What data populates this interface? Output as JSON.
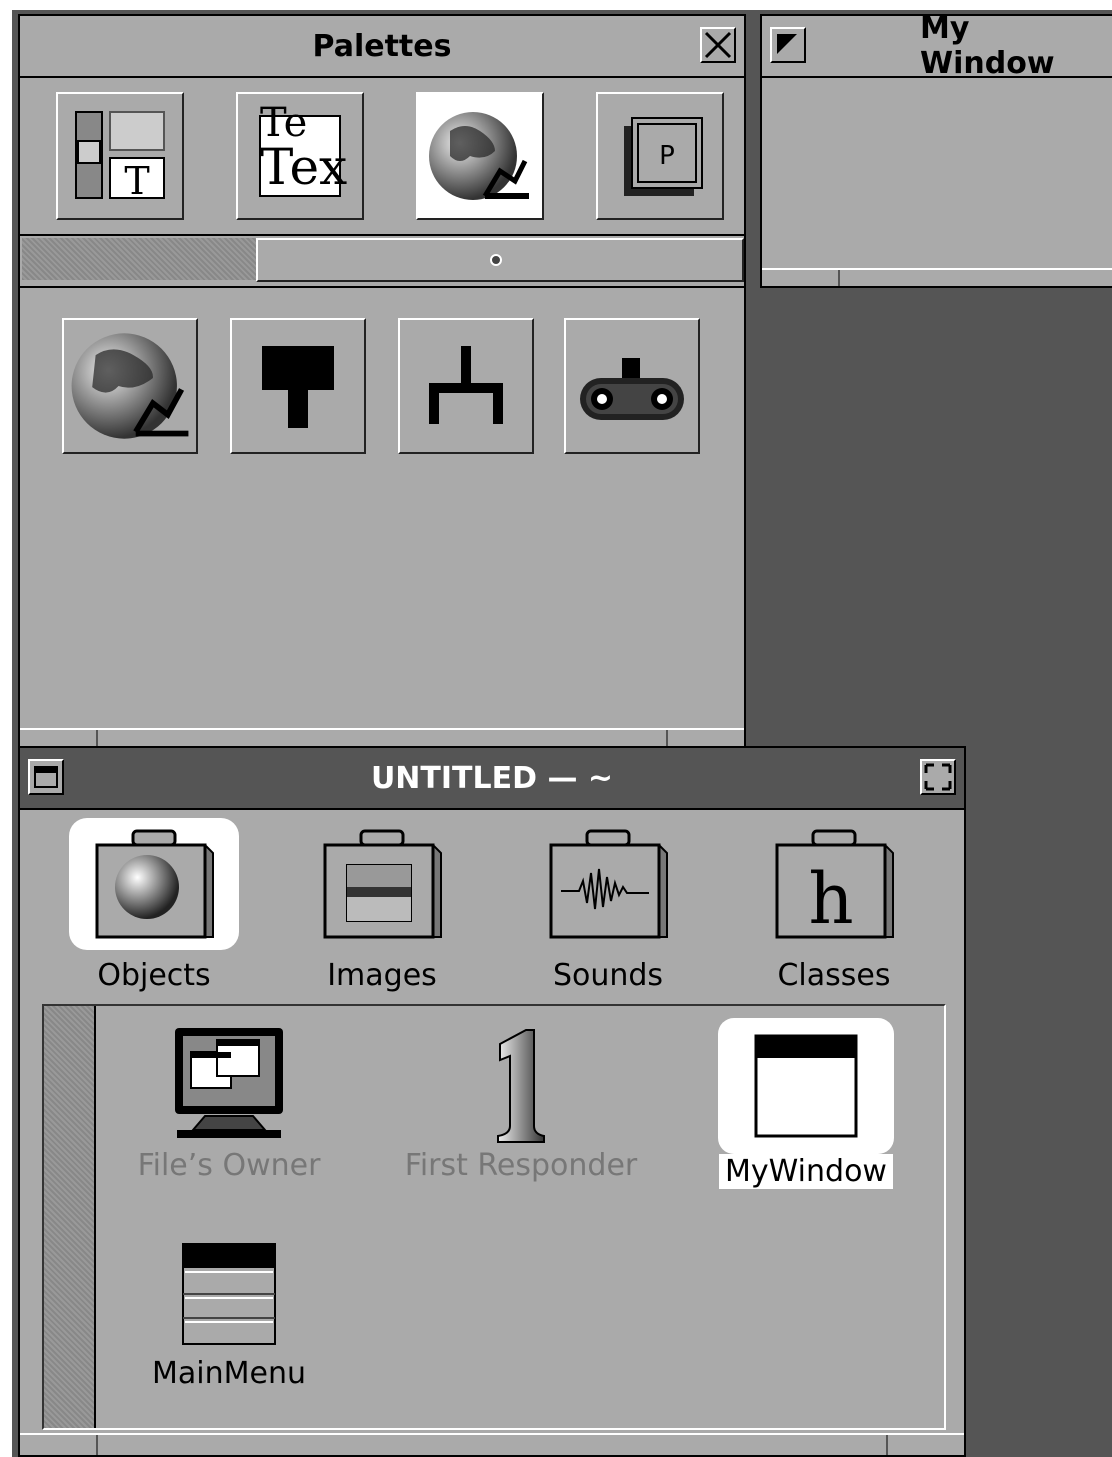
{
  "palettes_window": {
    "title": "Palettes",
    "close_icon": "close-icon",
    "palette_buttons": [
      "views-palette-icon",
      "text-palette-icon",
      "web-objects-palette-icon",
      "panel-palette-icon"
    ],
    "tools": [
      "globe-robot-icon",
      "hammer-icon",
      "fork-icon",
      "tank-robot-icon"
    ]
  },
  "my_window": {
    "title": "My Window",
    "miniaturize_icon": "miniaturize-icon"
  },
  "untitled_window": {
    "title": "UNTITLED — ~",
    "categories": [
      {
        "label": "Objects",
        "icon": "objects-suitcase-icon",
        "selected": true
      },
      {
        "label": "Images",
        "icon": "images-suitcase-icon",
        "selected": false
      },
      {
        "label": "Sounds",
        "icon": "sounds-suitcase-icon",
        "selected": false
      },
      {
        "label": "Classes",
        "icon": "classes-suitcase-icon",
        "selected": false
      }
    ],
    "objects": [
      {
        "label": "File’s Owner",
        "icon": "computer-icon",
        "state": "dim"
      },
      {
        "label": "First Responder",
        "icon": "number-one-icon",
        "state": "dim"
      },
      {
        "label": "MyWindow",
        "icon": "window-icon",
        "state": "selected"
      },
      {
        "label": "MainMenu",
        "icon": "menu-icon",
        "state": "normal"
      }
    ]
  },
  "colors": {
    "window_gray": "#aaaaaa",
    "desktop_dark": "#555555",
    "active_title": "#555555",
    "highlight": "#ffffff"
  }
}
